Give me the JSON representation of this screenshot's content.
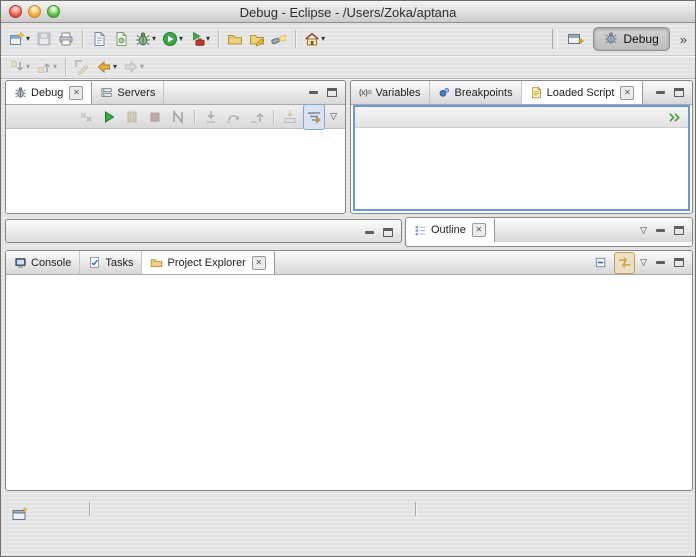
{
  "window": {
    "title": "Debug - Eclipse - /Users/Zoka/aptana"
  },
  "glyphs": {
    "close": "✕",
    "dropdown": "▾",
    "view_menu": "▽",
    "chevron": "»",
    "variables_icon": "(x)="
  },
  "perspective_bar": {
    "debug_label": "Debug"
  },
  "debug_panel": {
    "tabs": [
      {
        "label": "Debug"
      },
      {
        "label": "Servers"
      }
    ]
  },
  "right_panel": {
    "tabs": [
      {
        "label": "Variables"
      },
      {
        "label": "Breakpoints"
      },
      {
        "label": "Loaded Script"
      }
    ]
  },
  "outline_panel": {
    "tabs": [
      {
        "label": "Outline"
      }
    ]
  },
  "bottom_panel": {
    "tabs": [
      {
        "label": "Console"
      },
      {
        "label": "Tasks"
      },
      {
        "label": "Project Explorer"
      }
    ]
  }
}
